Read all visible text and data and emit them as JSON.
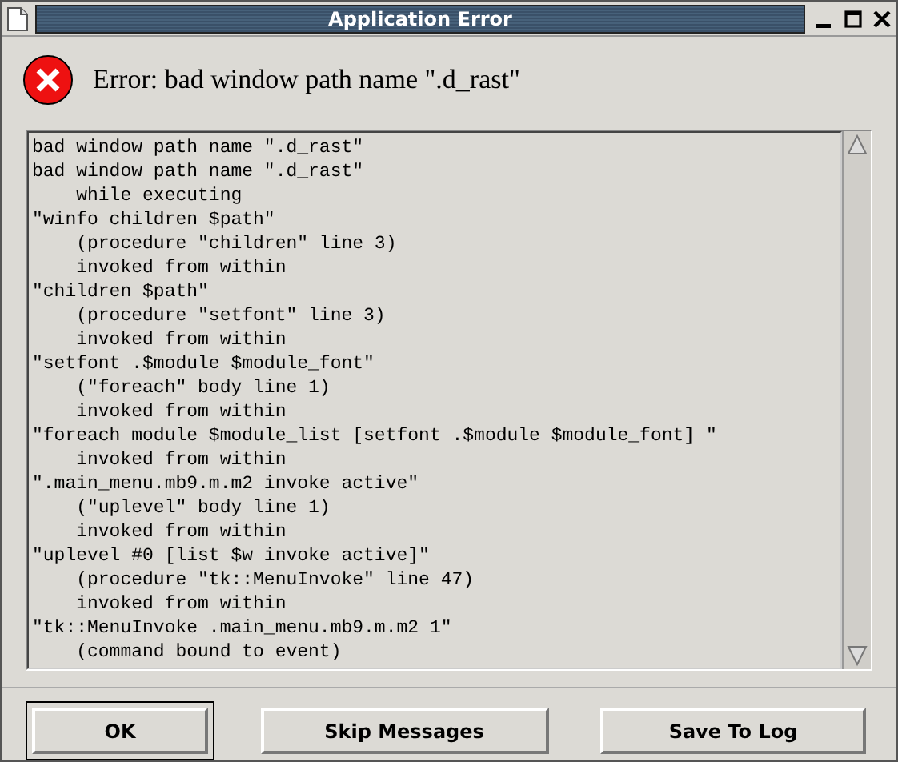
{
  "window": {
    "title": "Application Error"
  },
  "message": "Error: bad window path name \".d_rast\"",
  "trace_lines": [
    "bad window path name \".d_rast\"",
    "bad window path name \".d_rast\"",
    "    while executing",
    "\"winfo children $path\"",
    "    (procedure \"children\" line 3)",
    "    invoked from within",
    "\"children $path\"",
    "    (procedure \"setfont\" line 3)",
    "    invoked from within",
    "\"setfont .$module $module_font\"",
    "    (\"foreach\" body line 1)",
    "    invoked from within",
    "\"foreach module $module_list [setfont .$module $module_font] \"",
    "    invoked from within",
    "\".main_menu.mb9.m.m2 invoke active\"",
    "    (\"uplevel\" body line 1)",
    "    invoked from within",
    "\"uplevel #0 [list $w invoke active]\"",
    "    (procedure \"tk::MenuInvoke\" line 47)",
    "    invoked from within",
    "\"tk::MenuInvoke .main_menu.mb9.m.m2 1\"",
    "    (command bound to event)"
  ],
  "buttons": [
    {
      "label": "OK",
      "default": true
    },
    {
      "label": "Skip Messages",
      "default": false
    },
    {
      "label": "Save To Log",
      "default": false
    }
  ]
}
